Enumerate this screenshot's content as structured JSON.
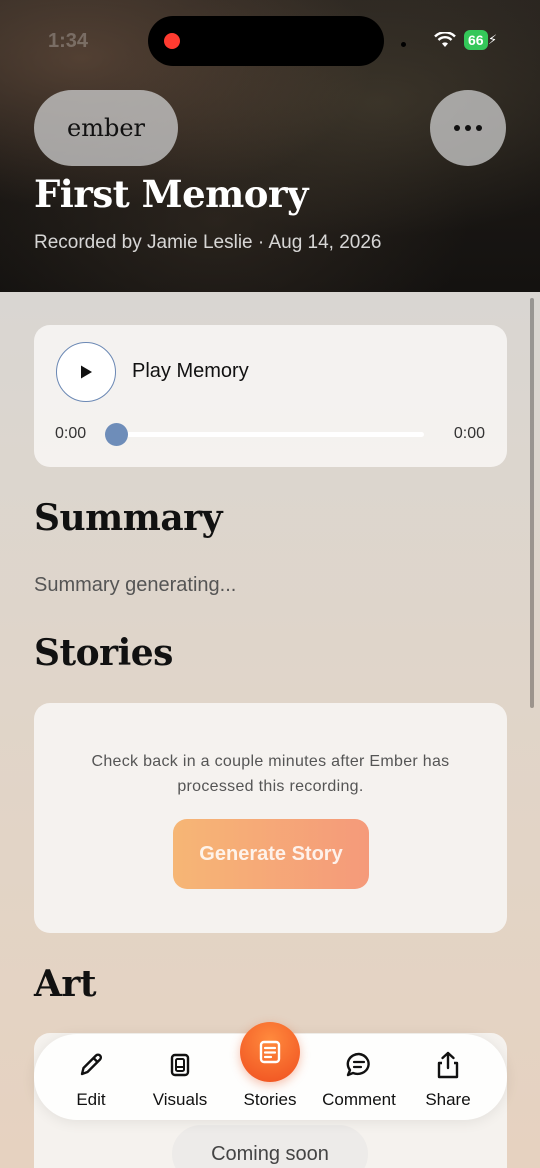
{
  "status_bar": {
    "time": "1:34",
    "battery": "66"
  },
  "header": {
    "app_button": "ember",
    "title": "First Memory",
    "subtitle": "Recorded by Jamie Leslie · Aug 14, 2026"
  },
  "player": {
    "label": "Play Memory",
    "current_time": "0:00",
    "duration": "0:00",
    "progress": 0
  },
  "summary": {
    "heading": "Summary",
    "text": "Summary generating..."
  },
  "stories": {
    "heading": "Stories",
    "message": "Check back in a couple minutes after Ember has processed this recording.",
    "button": "Generate Story"
  },
  "art": {
    "heading": "Art",
    "badge": "Coming soon"
  },
  "tabbar": {
    "items": [
      {
        "label": "Edit",
        "icon": "pencil-icon"
      },
      {
        "label": "Visuals",
        "icon": "gallery-icon"
      },
      {
        "label": "Stories",
        "icon": "document-icon"
      },
      {
        "label": "Comment",
        "icon": "chat-bubble-icon"
      },
      {
        "label": "Share",
        "icon": "share-icon"
      }
    ]
  },
  "colors": {
    "accent": "#ef4e1f",
    "player_accent": "#6e8db9",
    "generate_gradient": [
      "#f6b675",
      "#f59a7a"
    ]
  }
}
